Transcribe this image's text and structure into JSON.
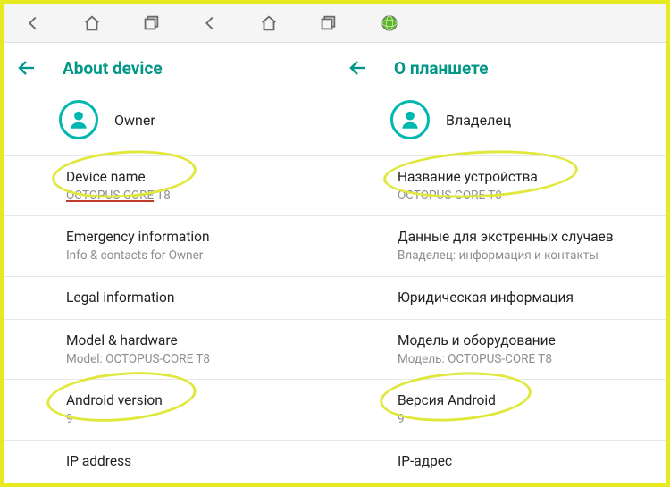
{
  "left": {
    "title": "About device",
    "owner": "Owner",
    "items": [
      {
        "title": "Device name",
        "sub": "OCTOPUS-CORE T8",
        "circle": "c1",
        "redline": true
      },
      {
        "title": "Emergency information",
        "sub": "Info & contacts for Owner"
      },
      {
        "title": "Legal information"
      },
      {
        "title": "Model & hardware",
        "sub": "Model: OCTOPUS-CORE T8"
      },
      {
        "title": "Android version",
        "sub": "9",
        "circle": "c3"
      },
      {
        "title": "IP address"
      }
    ]
  },
  "right": {
    "title": "О планшете",
    "owner": "Владелец",
    "items": [
      {
        "title": "Название устройства",
        "sub": "OCTOPUS-CORE T8",
        "circle": "c2"
      },
      {
        "title": "Данные для экстренных случаев",
        "sub": "Владелец: информация и контакты"
      },
      {
        "title": "Юридическая информация"
      },
      {
        "title": "Модель и оборудование",
        "sub": "Модель: OCTOPUS-CORE T8"
      },
      {
        "title": "Версия Android",
        "sub": "9",
        "circle": "c4"
      },
      {
        "title": "IP-адрес"
      }
    ]
  }
}
